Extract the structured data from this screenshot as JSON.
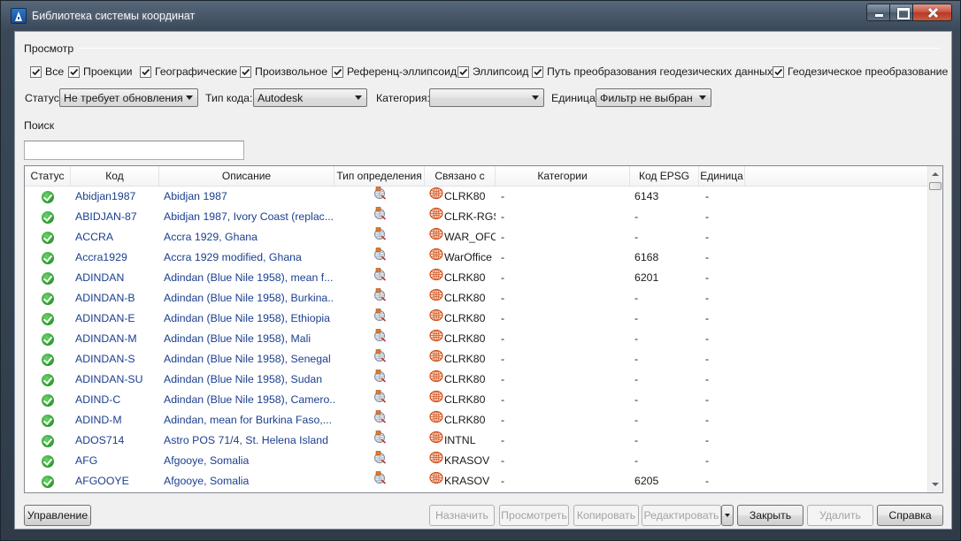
{
  "window": {
    "title": "Библиотека системы координат",
    "app_icon": "autodesk-a-icon",
    "controls": [
      "minimize-icon",
      "maximize-icon",
      "close-icon"
    ]
  },
  "view": {
    "label": "Просмотр",
    "checkboxes": [
      {
        "label": "Все",
        "checked": true
      },
      {
        "label": "Проекции",
        "checked": true
      },
      {
        "label": "Географические",
        "checked": true
      },
      {
        "label": "Произвольное",
        "checked": true
      },
      {
        "label": "Референц-эллипсоид",
        "checked": true
      },
      {
        "label": "Эллипсоид",
        "checked": true
      },
      {
        "label": "Путь преобразования геодезических данных",
        "checked": true
      },
      {
        "label": "Геодезическое преобразование",
        "checked": true
      }
    ]
  },
  "filters": {
    "status": {
      "label": "Статус:",
      "value": "Не требует обновления"
    },
    "code_type": {
      "label": "Тип кода:",
      "value": "Autodesk"
    },
    "category": {
      "label": "Категория:",
      "value": ""
    },
    "unit": {
      "label": "Единица:",
      "value": "Фильтр не выбран"
    }
  },
  "search": {
    "label": "Поиск",
    "value": ""
  },
  "table": {
    "columns": [
      "Статус",
      "Код",
      "Описание",
      "Тип определения",
      "Связано с",
      "Категории",
      "Код EPSG",
      "Единица"
    ],
    "status_icon": "status-ok-icon",
    "type_icon": "definition-type-icon",
    "linked_icon": "ellipsoid-icon",
    "rows": [
      {
        "code": "Abidjan1987",
        "description": "Abidjan 1987",
        "linked": "CLRK80",
        "categories": "-",
        "epsg": "6143",
        "unit": "-"
      },
      {
        "code": "ABIDJAN-87",
        "description": "Abidjan 1987, Ivory Coast (replac...",
        "linked": "CLRK-RGS",
        "categories": "-",
        "epsg": "-",
        "unit": "-"
      },
      {
        "code": "ACCRA",
        "description": "Accra 1929, Ghana",
        "linked": "WAR_OFC",
        "categories": "-",
        "epsg": "-",
        "unit": "-"
      },
      {
        "code": "Accra1929",
        "description": "Accra 1929 modified, Ghana",
        "linked": "WarOffice",
        "categories": "-",
        "epsg": "6168",
        "unit": "-"
      },
      {
        "code": "ADINDAN",
        "description": "Adindan (Blue Nile 1958), mean f...",
        "linked": "CLRK80",
        "categories": "-",
        "epsg": "6201",
        "unit": "-"
      },
      {
        "code": "ADINDAN-B",
        "description": "Adindan (Blue Nile 1958), Burkina...",
        "linked": "CLRK80",
        "categories": "-",
        "epsg": "-",
        "unit": "-"
      },
      {
        "code": "ADINDAN-E",
        "description": "Adindan (Blue Nile 1958), Ethiopia",
        "linked": "CLRK80",
        "categories": "-",
        "epsg": "-",
        "unit": "-"
      },
      {
        "code": "ADINDAN-M",
        "description": "Adindan (Blue Nile 1958), Mali",
        "linked": "CLRK80",
        "categories": "-",
        "epsg": "-",
        "unit": "-"
      },
      {
        "code": "ADINDAN-S",
        "description": "Adindan (Blue Nile 1958), Senegal",
        "linked": "CLRK80",
        "categories": "-",
        "epsg": "-",
        "unit": "-"
      },
      {
        "code": "ADINDAN-SU",
        "description": "Adindan (Blue Nile 1958), Sudan",
        "linked": "CLRK80",
        "categories": "-",
        "epsg": "-",
        "unit": "-"
      },
      {
        "code": "ADIND-C",
        "description": "Adindan (Blue Nile 1958), Camero...",
        "linked": "CLRK80",
        "categories": "-",
        "epsg": "-",
        "unit": "-"
      },
      {
        "code": "ADIND-M",
        "description": "Adindan, mean for Burkina Faso,...",
        "linked": "CLRK80",
        "categories": "-",
        "epsg": "-",
        "unit": "-"
      },
      {
        "code": "ADOS714",
        "description": "Astro POS 71/4, St. Helena Island",
        "linked": "INTNL",
        "categories": "-",
        "epsg": "-",
        "unit": "-"
      },
      {
        "code": "AFG",
        "description": "Afgooye, Somalia",
        "linked": "KRASOV",
        "categories": "-",
        "epsg": "-",
        "unit": "-"
      },
      {
        "code": "AFGOOYE",
        "description": "Afgooye, Somalia",
        "linked": "KRASOV",
        "categories": "-",
        "epsg": "6205",
        "unit": "-"
      }
    ]
  },
  "buttons": {
    "manage": {
      "label": "Управление",
      "enabled": true
    },
    "assign": {
      "label": "Назначить",
      "enabled": false
    },
    "view": {
      "label": "Просмотреть",
      "enabled": false
    },
    "copy": {
      "label": "Копировать",
      "enabled": false
    },
    "edit": {
      "label": "Редактировать",
      "enabled": false
    },
    "close": {
      "label": "Закрыть",
      "enabled": true
    },
    "delete": {
      "label": "Удалить",
      "enabled": false
    },
    "help": {
      "label": "Справка",
      "enabled": true
    }
  },
  "colors": {
    "link_text": "#1b3f8f",
    "status_ok": "#2c9a2c",
    "close_button": "#c9523f"
  }
}
